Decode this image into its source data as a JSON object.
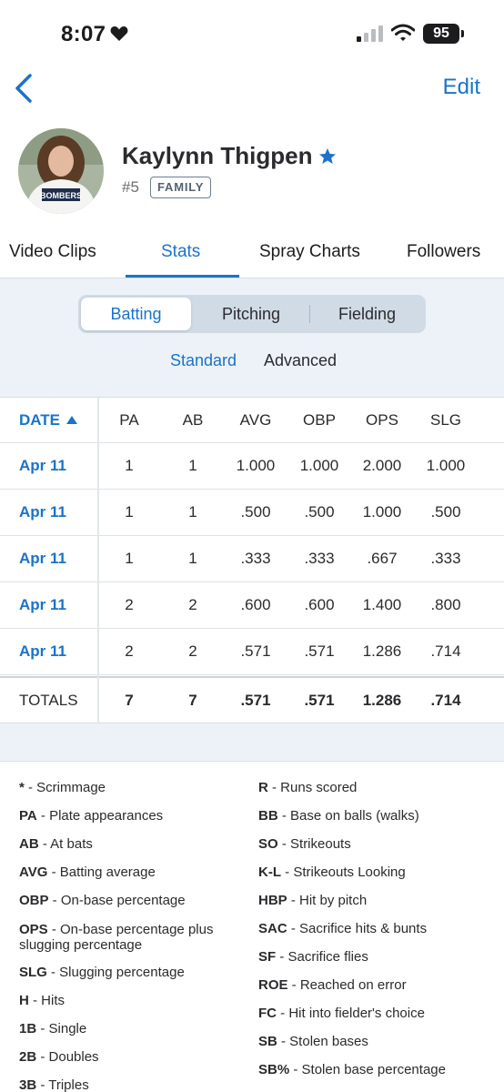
{
  "status_bar": {
    "time": "8:07",
    "battery": "95"
  },
  "nav": {
    "edit_label": "Edit"
  },
  "profile": {
    "name": "Kaylynn Thigpen",
    "number": "#5",
    "role_badge": "FAMILY",
    "avatar_shirt_text": "BOMBERS"
  },
  "tabs": [
    "Video Clips",
    "Stats",
    "Spray Charts",
    "Followers"
  ],
  "segments": [
    "Batting",
    "Pitching",
    "Fielding"
  ],
  "subtabs": [
    "Standard",
    "Advanced"
  ],
  "table": {
    "columns": [
      "DATE",
      "PA",
      "AB",
      "AVG",
      "OBP",
      "OPS",
      "SLG"
    ],
    "rows": [
      [
        "Apr 11",
        "1",
        "1",
        "1.000",
        "1.000",
        "2.000",
        "1.000"
      ],
      [
        "Apr 11",
        "1",
        "1",
        ".500",
        ".500",
        "1.000",
        ".500"
      ],
      [
        "Apr 11",
        "1",
        "1",
        ".333",
        ".333",
        ".667",
        ".333"
      ],
      [
        "Apr 11",
        "2",
        "2",
        ".600",
        ".600",
        "1.400",
        ".800"
      ],
      [
        "Apr 11",
        "2",
        "2",
        ".571",
        ".571",
        "1.286",
        ".714"
      ]
    ],
    "totals": [
      "TOTALS",
      "7",
      "7",
      ".571",
      ".571",
      "1.286",
      ".714"
    ]
  },
  "legend_left": [
    {
      "abbr": "*",
      "desc": " - Scrimmage"
    },
    {
      "abbr": "PA",
      "desc": " - Plate appearances"
    },
    {
      "abbr": "AB",
      "desc": " - At bats"
    },
    {
      "abbr": "AVG",
      "desc": " - Batting average"
    },
    {
      "abbr": "OBP",
      "desc": " - On-base percentage"
    },
    {
      "abbr": "OPS",
      "desc": " - On-base percentage plus slugging percentage"
    },
    {
      "abbr": "SLG",
      "desc": " - Slugging percentage"
    },
    {
      "abbr": "H",
      "desc": " - Hits"
    },
    {
      "abbr": "1B",
      "desc": " - Single"
    },
    {
      "abbr": "2B",
      "desc": " - Doubles"
    },
    {
      "abbr": "3B",
      "desc": " - Triples"
    }
  ],
  "legend_right": [
    {
      "abbr": "R",
      "desc": " - Runs scored"
    },
    {
      "abbr": "BB",
      "desc": " - Base on balls (walks)"
    },
    {
      "abbr": "SO",
      "desc": " - Strikeouts"
    },
    {
      "abbr": "K-L",
      "desc": " - Strikeouts Looking"
    },
    {
      "abbr": "HBP",
      "desc": " - Hit by pitch"
    },
    {
      "abbr": "SAC",
      "desc": " - Sacrifice hits & bunts"
    },
    {
      "abbr": "SF",
      "desc": " - Sacrifice flies"
    },
    {
      "abbr": "ROE",
      "desc": " - Reached on error"
    },
    {
      "abbr": "FC",
      "desc": " - Hit into fielder's choice"
    },
    {
      "abbr": "SB",
      "desc": " - Stolen bases"
    },
    {
      "abbr": "SB%",
      "desc": " - Stolen base percentage"
    }
  ],
  "colors": {
    "accent": "#1a73c8",
    "panel_bg": "#edf2f8",
    "text": "#1c1c1e"
  }
}
